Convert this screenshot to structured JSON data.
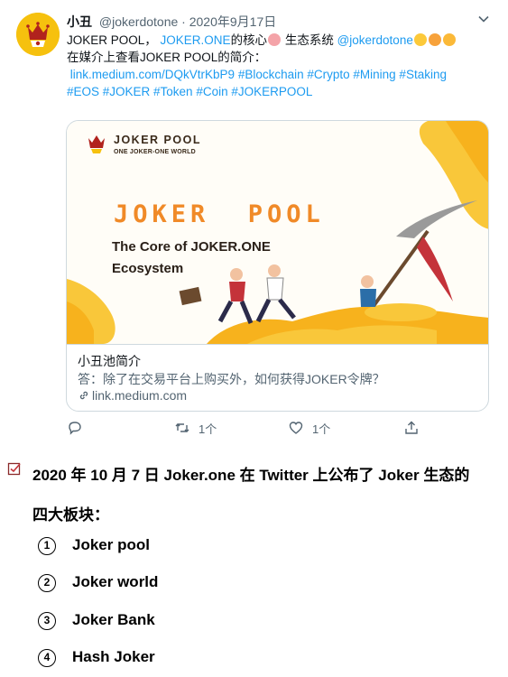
{
  "tweet": {
    "display_name": "小丑",
    "handle": "@jokerdotone",
    "separator": "·",
    "date": "2020年9月17日",
    "text_line1_a": "JOKER POOL，",
    "text_line1_link": "JOKER.ONE",
    "text_line1_b": "的核心",
    "text_line1_c": " 生态系统 ",
    "text_line1_mention": "@jokerdotone",
    "text_line2": "在媒介上查看JOKER POOL的简介：",
    "text_line3_link": "link.medium.com/DQkVtrKbP9",
    "text_line3_tags": "#Blockchain #Crypto #Mining #Staking",
    "text_line4_tags": "#EOS #JOKER #Token #Coin #JOKERPOOL"
  },
  "card": {
    "image": {
      "logo_text": "JOKER POOL",
      "logo_sub": "ONE JOKER-ONE WORLD",
      "title": "JOKER  POOL",
      "subtitle_line1": "The Core of JOKER.ONE",
      "subtitle_line2": "Ecosystem"
    },
    "title": "小丑池简介",
    "description": "答：除了在交易平台上购买外，如何获得JOKER令牌？",
    "domain": "link.medium.com"
  },
  "actions": {
    "reply_count": "",
    "retweet_count": "1个",
    "like_count": "1个"
  },
  "article": {
    "para_line1": "2020 年 10 月 7 日 Joker.one 在 Twitter 上公布了 Joker 生态的",
    "para_line2": "四大板块：",
    "items": [
      {
        "num": "1",
        "label": "Joker pool"
      },
      {
        "num": "2",
        "label": "Joker world"
      },
      {
        "num": "3",
        "label": "Joker Bank"
      },
      {
        "num": "4",
        "label": "Hash Joker"
      }
    ]
  },
  "colors": {
    "link": "#1d9bf0",
    "muted": "#536471",
    "border": "#cfd9de",
    "accent_orange": "#f08a28",
    "avatar_bg": "#f6c10e"
  }
}
